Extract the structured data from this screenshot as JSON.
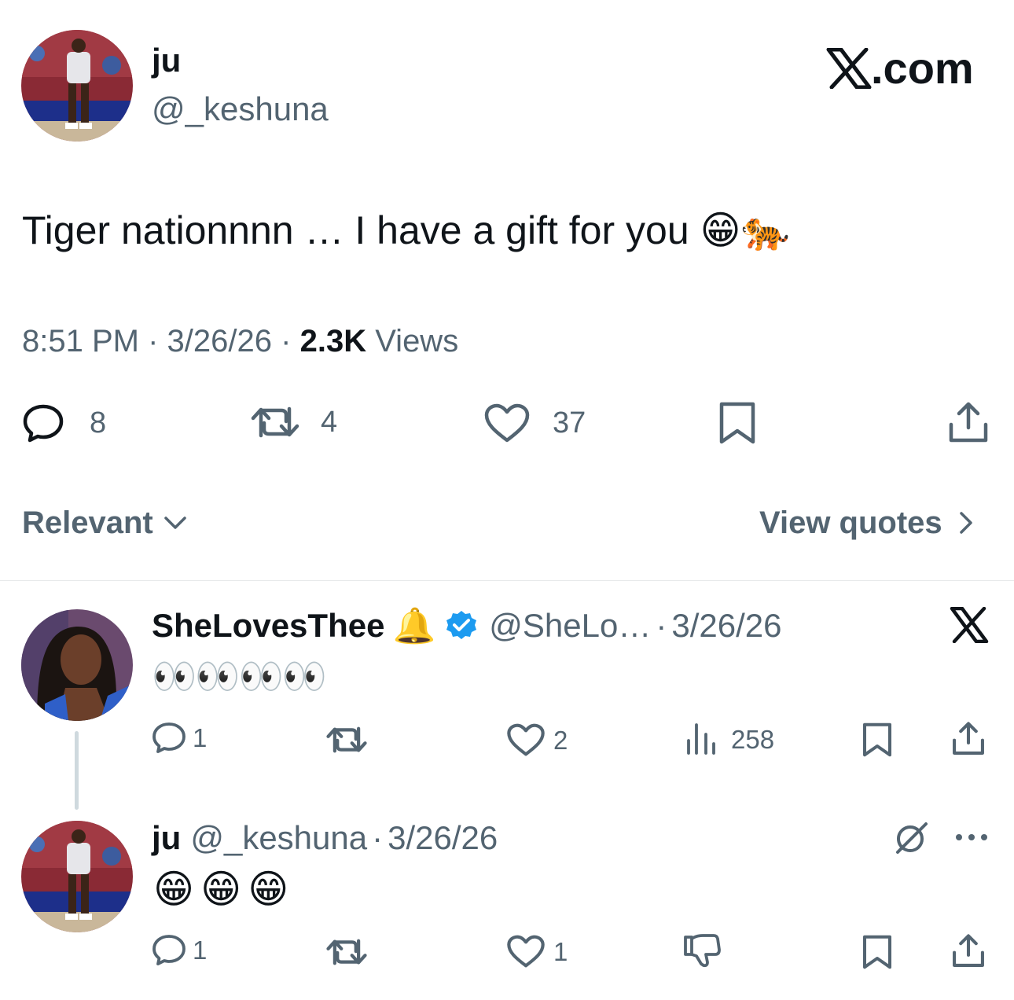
{
  "main_tweet": {
    "author_name": "ju",
    "author_handle": "@_keshuna",
    "site_label": "X.com",
    "text": "Tiger nationnnn … I have a gift for you",
    "text_emojis": "😁🐅",
    "time": "8:51 PM",
    "sep1": "·",
    "date": "3/26/26",
    "sep2": "·",
    "views_count": "2.3K",
    "views_label": "Views",
    "replies": "8",
    "reposts": "4",
    "likes": "37"
  },
  "sort": {
    "label": "Relevant",
    "quotes_label": "View quotes"
  },
  "reply1": {
    "name": "SheLovesThee",
    "name_emoji": "🔔",
    "handle": "@SheLo…",
    "sep": "·",
    "date": "3/26/26",
    "text": "👀👀👀👀",
    "replies": "1",
    "likes": "2",
    "views": "258"
  },
  "reply2": {
    "name": "ju",
    "handle": "@_keshuna",
    "sep": "·",
    "date": "3/26/26",
    "text": "😁😁😁",
    "replies": "1",
    "likes": "1"
  },
  "colors": {
    "text": "#0f1419",
    "secondary": "#536471",
    "verified": "#1d9bf0",
    "divider": "#e7e9ea"
  },
  "icons": [
    "reply-icon",
    "repost-icon",
    "like-icon",
    "bookmark-icon",
    "share-icon",
    "views-icon",
    "dislike-icon",
    "grok-icon",
    "more-icon",
    "x-logo-icon",
    "verified-badge-icon",
    "chevron-down-icon",
    "chevron-right-icon"
  ]
}
